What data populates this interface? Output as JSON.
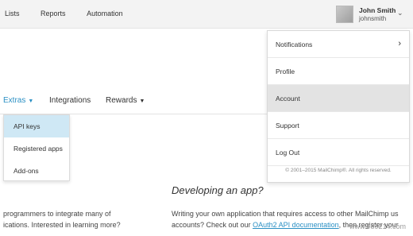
{
  "topnav": {
    "lists": "Lists",
    "reports": "Reports",
    "automation": "Automation"
  },
  "user": {
    "name": "John Smith",
    "handle": "johnsmith"
  },
  "subnav": {
    "extras": "Extras",
    "integrations": "Integrations",
    "rewards": "Rewards"
  },
  "extras_menu": [
    "API keys",
    "Registered apps",
    "Add-ons"
  ],
  "user_menu": {
    "items": [
      "Notifications",
      "Profile",
      "Account",
      "Support",
      "Log Out"
    ],
    "copyright": "© 2001–2015 MailChimp®. All rights reserved."
  },
  "content": {
    "heading": "Developing an app?",
    "left_line1": "programmers to integrate many of",
    "left_line2": "ications. Interested in learning more?",
    "right_line1": "Writing your own application that requires access to other MailChimp us",
    "right_line2_pre": "accounts? Check out our ",
    "right_line2_link": "OAuth2 API documentation",
    "right_line2_post": ", then register your"
  },
  "watermark": "www.989214.com",
  "colors": {
    "accent": "#2b90c4",
    "active_menu": "#cfe8f5",
    "topbar": "#f3f3f3"
  }
}
